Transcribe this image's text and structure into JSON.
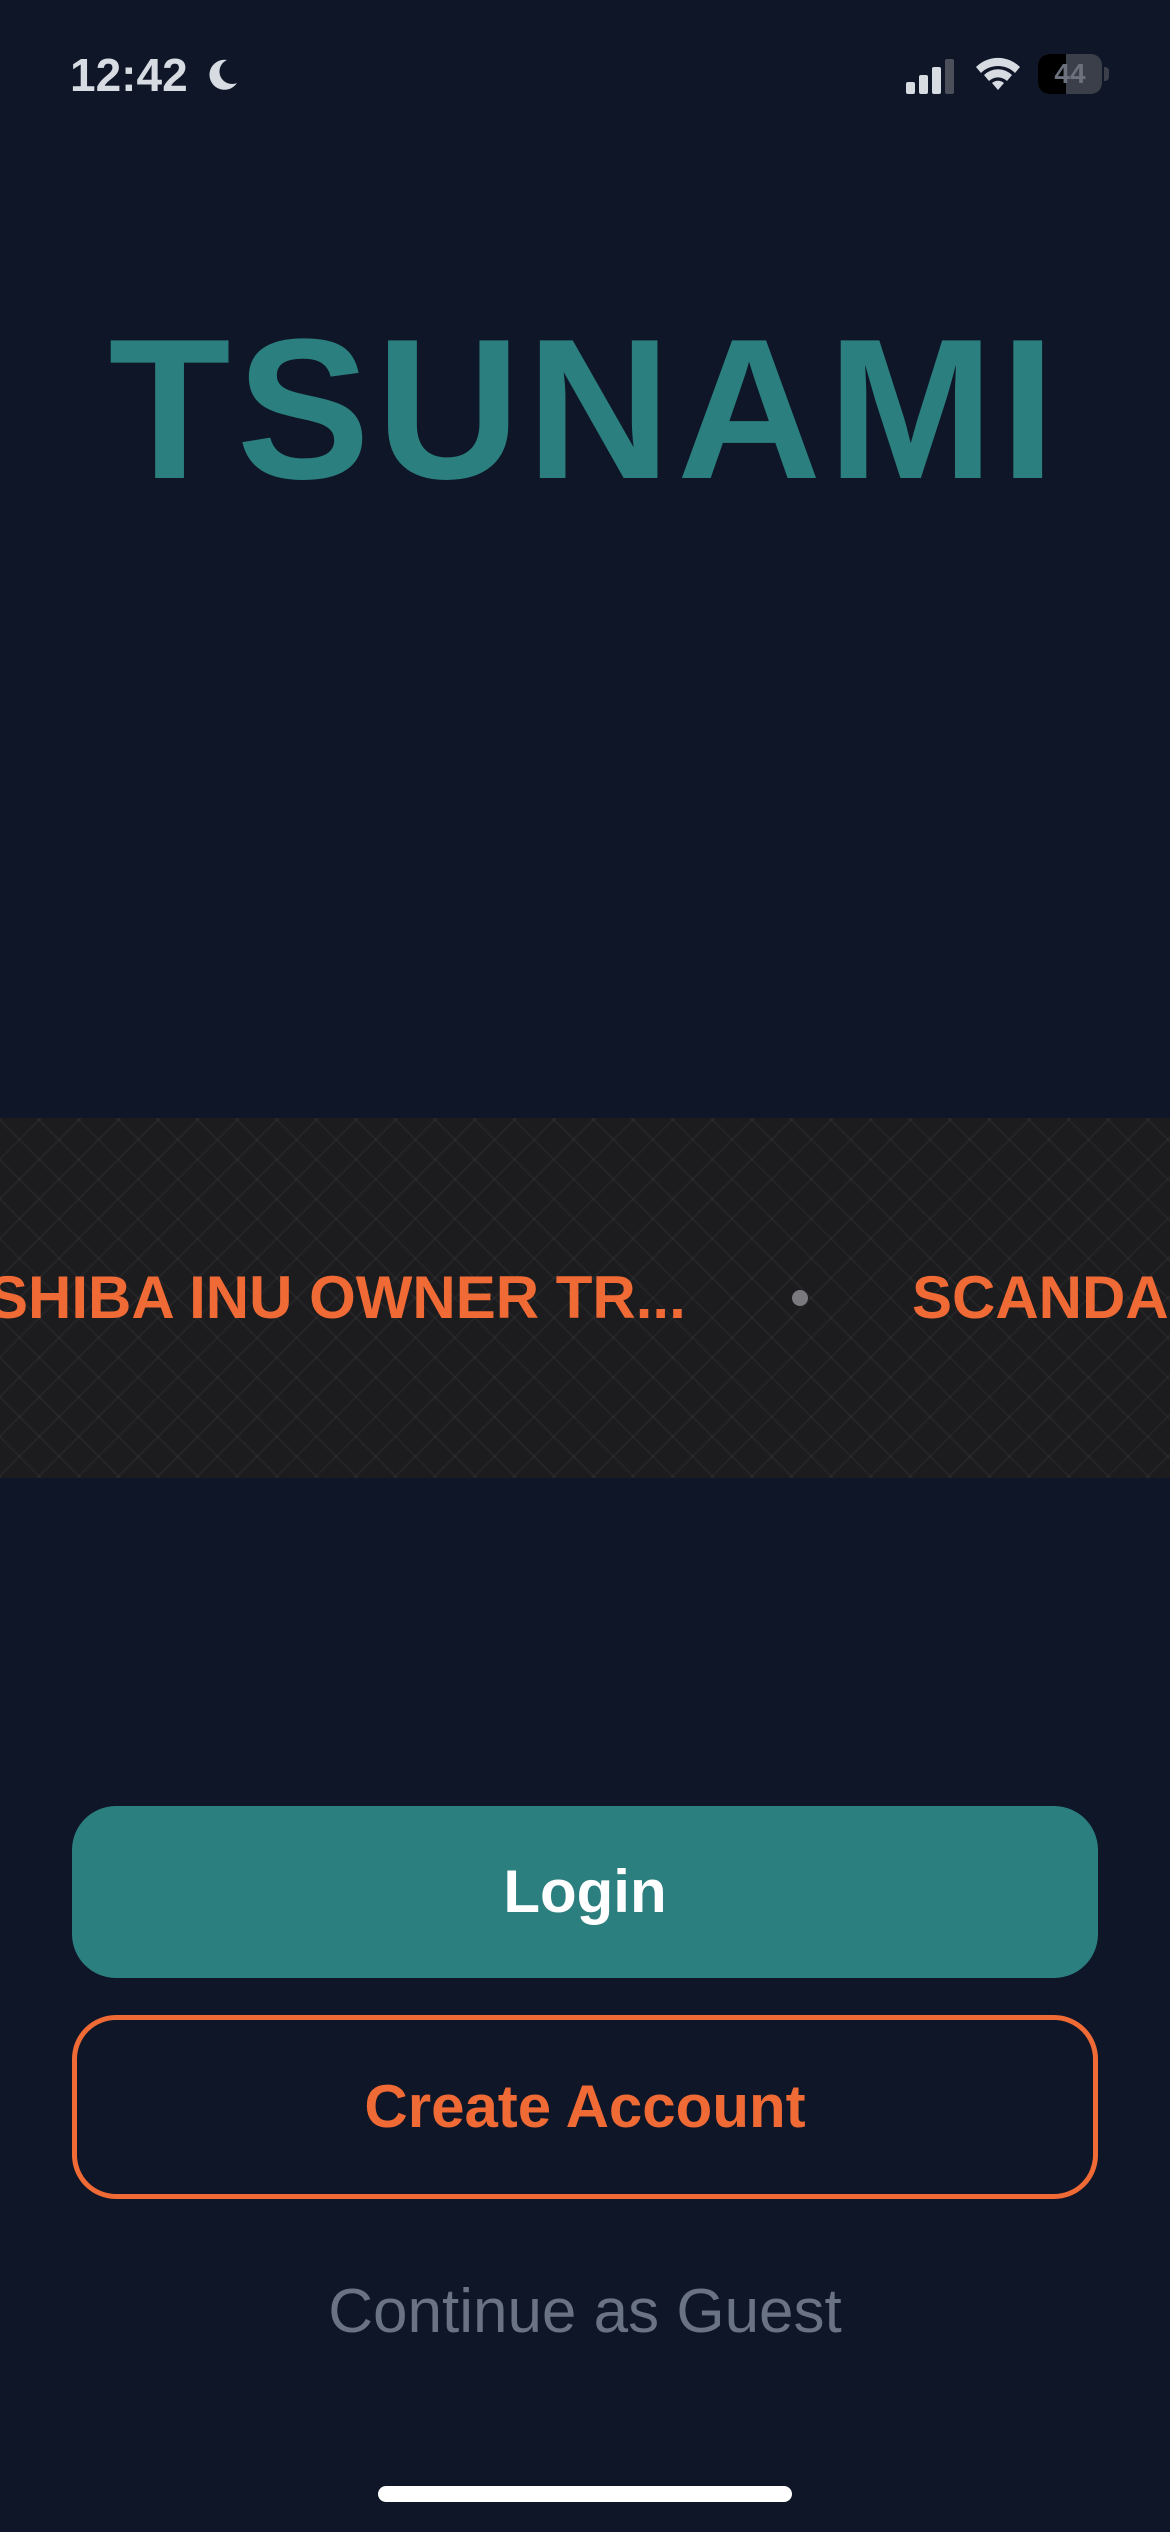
{
  "status_bar": {
    "time": "12:42",
    "battery_level": "44",
    "battery_fraction": 0.44,
    "icons": [
      "moon-icon",
      "cellular-signal-icon",
      "wifi-icon",
      "battery-icon"
    ]
  },
  "app": {
    "logo_text": "TSUNAMI"
  },
  "ticker": {
    "items": [
      "SHIBA INU OWNER TR...",
      "SCANDA"
    ],
    "separator_icon": "dot-separator-icon"
  },
  "actions": {
    "login_label": "Login",
    "create_account_label": "Create Account",
    "guest_label": "Continue as Guest"
  },
  "colors": {
    "background": "#0e1627",
    "primary_teal": "#2b7f7e",
    "accent_orange": "#f06a35",
    "muted_text": "#6a7384",
    "ticker_background": "#1c1c1e"
  }
}
